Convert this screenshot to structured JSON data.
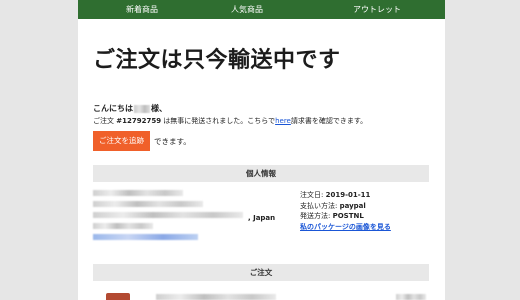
{
  "nav": {
    "items": [
      "新着商品",
      "人気商品",
      "アウトレット"
    ]
  },
  "headline": "ご注文は只今輸送中です",
  "greeting": {
    "prefix": "こんにちは",
    "suffix": "様、"
  },
  "message": {
    "part1": "ご注文 ",
    "order_no": "#12792759",
    "part2": " は無事に発送されました。こちらで",
    "link": "here",
    "part3": "請求書を確認できます。"
  },
  "track": {
    "button": "ご注文を追跡",
    "after": "できます。"
  },
  "sections": {
    "personal": "個人情報",
    "order": "ご注文"
  },
  "address": {
    "country": ", Japan"
  },
  "order_info": {
    "date_label": "注文日: ",
    "date": "2019-01-11",
    "payment_label": "支払い方法: ",
    "payment": "paypal",
    "shipping_label": "発送方法: ",
    "shipping": "POSTNL",
    "photo_link": "私のパッケージの画像を見る"
  },
  "colors": {
    "nav_bg": "#2f6e30",
    "accent": "#f0602a",
    "link": "#1a56d6"
  }
}
